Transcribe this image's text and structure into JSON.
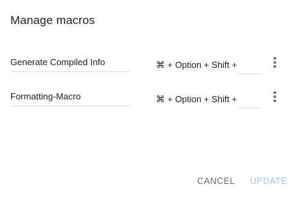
{
  "dialog": {
    "title": "Manage macros"
  },
  "macros": [
    {
      "name": "Generate Compiled Info",
      "shortcut_prefix": "⌘ + Option + Shift +",
      "key": "",
      "more_icon": "more-vert-icon"
    },
    {
      "name": "Formatting-Macro",
      "shortcut_prefix": "⌘ + Option + Shift +",
      "key": "",
      "more_icon": "more-vert-icon"
    }
  ],
  "actions": {
    "cancel_label": "CANCEL",
    "update_label": "UPDATE"
  },
  "colors": {
    "text": "#202124",
    "divider": "#dadce0",
    "cancel": "#6b6b6b",
    "update_disabled": "#a9c4ec",
    "icon": "#757575"
  }
}
